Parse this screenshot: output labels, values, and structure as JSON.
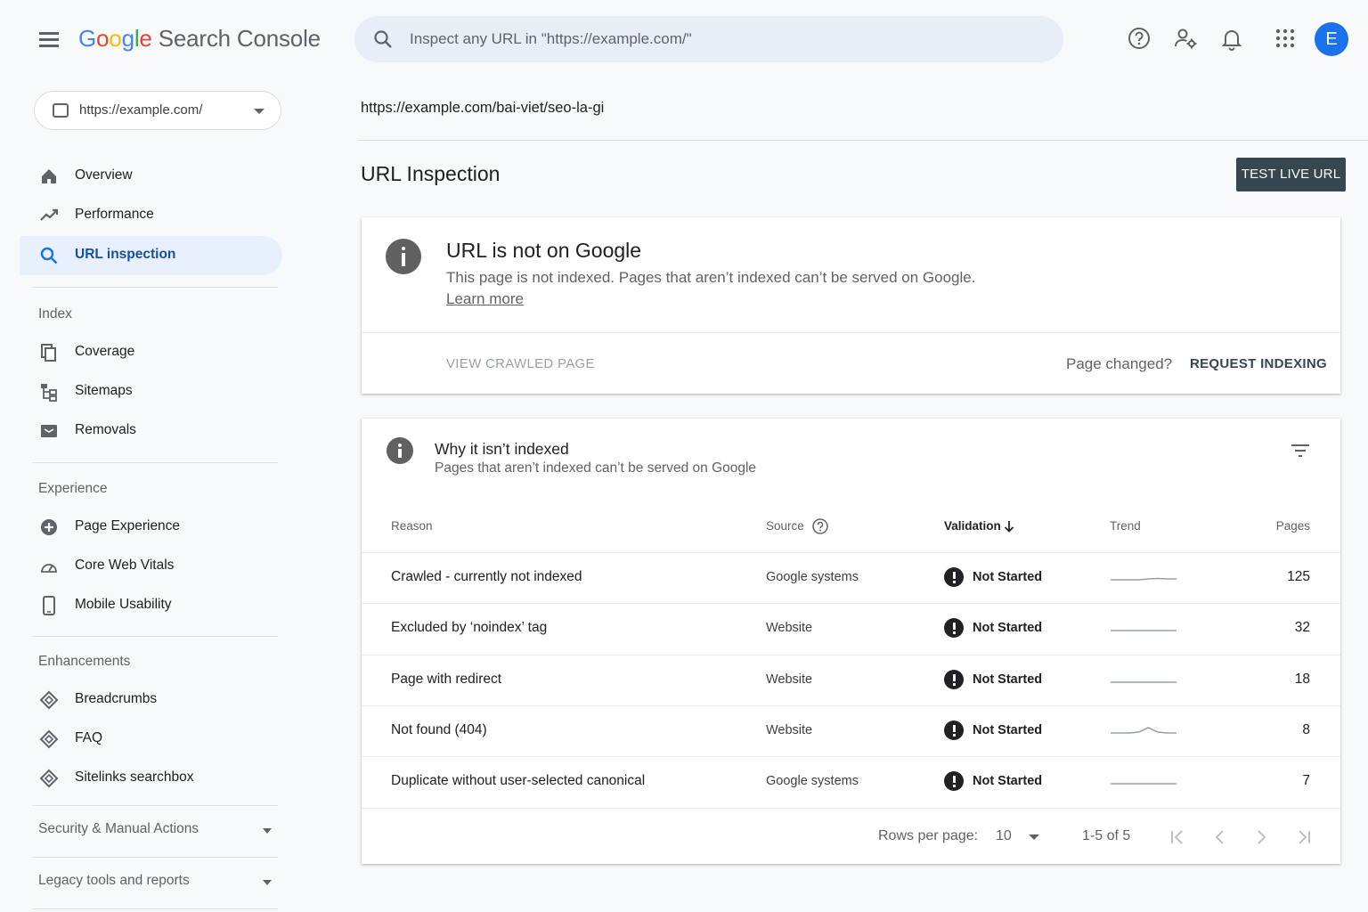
{
  "header": {
    "logo_google": [
      "G",
      "o",
      "o",
      "g",
      "l",
      "e"
    ],
    "logo_product": "Search Console",
    "search_placeholder": "Inspect any URL in \"https://example.com/\"",
    "avatar_letter": "E"
  },
  "sidebar": {
    "property": "https://example.com/",
    "top_items": [
      {
        "label": "Overview",
        "icon": "home-icon"
      },
      {
        "label": "Performance",
        "icon": "trending-up-icon"
      },
      {
        "label": "URL inspection",
        "icon": "search-icon",
        "active": true
      }
    ],
    "sections": [
      {
        "title": "Index",
        "items": [
          {
            "label": "Coverage",
            "icon": "copy-icon"
          },
          {
            "label": "Sitemaps",
            "icon": "sitemap-icon"
          },
          {
            "label": "Removals",
            "icon": "removals-icon"
          }
        ]
      },
      {
        "title": "Experience",
        "items": [
          {
            "label": "Page Experience",
            "icon": "plus-circle-icon"
          },
          {
            "label": "Core Web Vitals",
            "icon": "gauge-icon"
          },
          {
            "label": "Mobile Usability",
            "icon": "phone-icon"
          }
        ]
      },
      {
        "title": "Enhancements",
        "items": [
          {
            "label": "Breadcrumbs",
            "icon": "diamond-icon"
          },
          {
            "label": "FAQ",
            "icon": "diamond-icon"
          },
          {
            "label": "Sitelinks searchbox",
            "icon": "diamond-icon"
          }
        ]
      }
    ],
    "collapsibles": [
      "Security & Manual Actions",
      "Legacy tools and reports"
    ]
  },
  "main": {
    "inspected_url": "https://example.com/bai-viet/seo-la-gi",
    "title": "URL Inspection",
    "test_live_button": "TEST LIVE URL",
    "status_card": {
      "title": "URL is not on Google",
      "description": "This page is not indexed. Pages that aren’t indexed can’t be served on Google.",
      "learn_more": "Learn more",
      "view_crawled": "VIEW CRAWLED PAGE",
      "page_changed": "Page changed?",
      "request_indexing": "REQUEST INDEXING"
    },
    "why_card": {
      "title": "Why it isn’t indexed",
      "subtitle": "Pages that aren’t indexed can’t be served on Google",
      "columns": {
        "reason": "Reason",
        "source": "Source",
        "validation": "Validation",
        "trend": "Trend",
        "pages": "Pages"
      },
      "rows": [
        {
          "reason": "Crawled - currently not indexed",
          "source": "Google systems",
          "validation": "Not Started",
          "trend": [
            0,
            0,
            0,
            0,
            0.1,
            0.15,
            0.1,
            0.1
          ],
          "pages": "125"
        },
        {
          "reason": "Excluded by ‘noindex’ tag",
          "source": "Website",
          "validation": "Not Started",
          "trend": [
            0,
            0,
            0,
            0,
            0,
            0,
            0,
            0
          ],
          "pages": "32"
        },
        {
          "reason": "Page with redirect",
          "source": "Website",
          "validation": "Not Started",
          "trend": [
            0,
            0,
            0,
            0,
            0,
            0,
            0,
            0
          ],
          "pages": "18"
        },
        {
          "reason": "Not found (404)",
          "source": "Website",
          "validation": "Not Started",
          "trend": [
            0,
            0,
            0,
            0.1,
            0.6,
            0.1,
            0,
            0
          ],
          "pages": "8"
        },
        {
          "reason": "Duplicate without user-selected canonical",
          "source": "Google systems",
          "validation": "Not Started",
          "trend": [
            0,
            0,
            0,
            0,
            0,
            0,
            0,
            0
          ],
          "pages": "7"
        }
      ],
      "footer": {
        "rows_per_page_label": "Rows per page:",
        "rows_per_page_value": "10",
        "range": "1-5 of 5"
      }
    }
  },
  "colors": {
    "accent": "#1a73e8",
    "active_nav_bg": "#e8f0fe",
    "dark_button": "#37474f"
  }
}
